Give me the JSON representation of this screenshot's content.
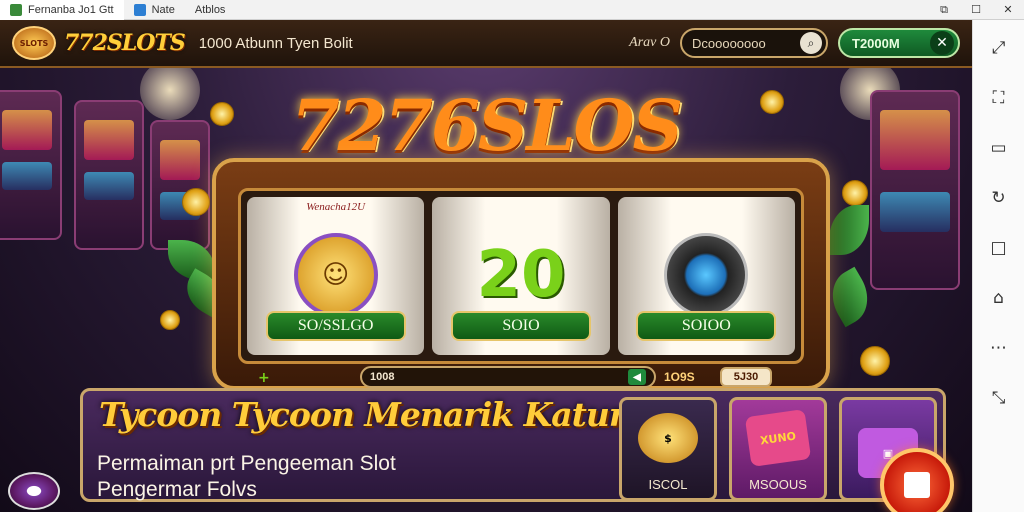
{
  "window": {
    "tab1_label": "Fernanba Jo1 Gtt",
    "tab2_label": "Nate",
    "tab3_label": "Atblos",
    "controls": [
      "⧉",
      "☐",
      "✕"
    ]
  },
  "header": {
    "logo_badge_text": "SLOTS",
    "brand": "772SLOTS",
    "marquee": "1000 Atbunn Tyen Bolit",
    "account_label": "Arav O",
    "search_value": "Dcoooooooo",
    "search_icon": "search-icon",
    "balance": "T2000M",
    "close_label": "✕"
  },
  "hero": {
    "title": "7276SLOS"
  },
  "reels": [
    {
      "header": "Wenacha12U",
      "symbol_text": "☺",
      "value": "SO/SSLGO"
    },
    {
      "header": "",
      "symbol_text": "20",
      "value": "SOIO"
    },
    {
      "header": "",
      "symbol_text": "",
      "value": "SOIOO"
    }
  ],
  "controls": {
    "strip_value": "1008",
    "strip_arrow": "◀",
    "left_mark": "+",
    "right_label": "1O9S",
    "right_box": "5J30"
  },
  "promo": {
    "title": "Tycoon Tycoon Menarik Katur",
    "desc_line1": "Permaiman prt Pengeeman Slot",
    "desc_line2": "Pengermar Folvs",
    "cards": [
      {
        "label": "ISCOL",
        "icon_text": "$"
      },
      {
        "label": "MSOOUS",
        "icon_text": "XUNO"
      },
      {
        "label": "",
        "icon_text": "▣"
      }
    ]
  },
  "sidebar": {
    "icons": [
      "⤢",
      "⛶",
      "▭",
      "↻",
      "□",
      "⌂",
      "⋯",
      "⤡"
    ]
  }
}
